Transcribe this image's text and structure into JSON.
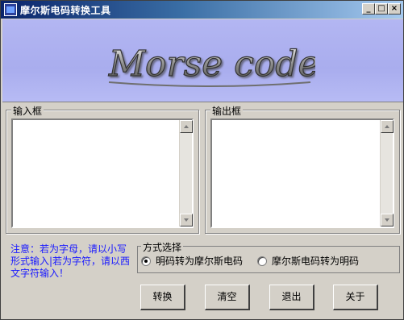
{
  "window": {
    "title": "摩尔斯电码转换工具",
    "icon": "app-icon",
    "controls": [
      "minimize-icon",
      "maximize-icon",
      "close-icon"
    ]
  },
  "banner": {
    "logo_text": "Morse code"
  },
  "input": {
    "label": "输入框",
    "value": ""
  },
  "output": {
    "label": "输出框",
    "value": ""
  },
  "note": "注意：若为字母，请以小写形式输入|若为字符，请以西文字符输入！",
  "mode": {
    "label": "方式选择",
    "options": [
      {
        "label": "明码转为摩尔斯电码",
        "checked": true
      },
      {
        "label": "摩尔斯电码转为明码",
        "checked": false
      }
    ]
  },
  "buttons": {
    "convert": "转换",
    "clear": "清空",
    "exit": "退出",
    "about": "关于"
  },
  "colors": {
    "note_text": "#1a1aff",
    "banner_bg": "#b3b6f2",
    "window_bg": "#d4d0c8"
  }
}
